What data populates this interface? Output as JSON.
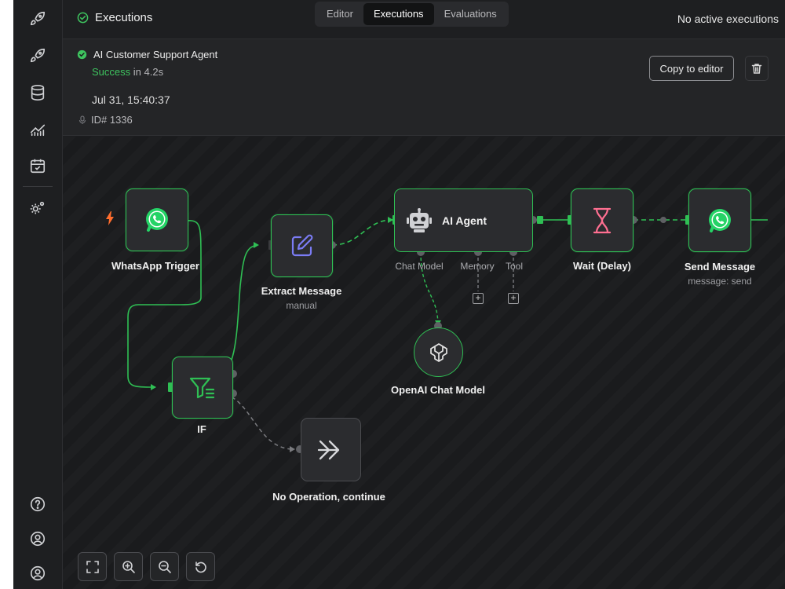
{
  "header": {
    "title": "Executions",
    "tabs": [
      {
        "label": "Editor"
      },
      {
        "label": "Executions"
      },
      {
        "label": "Evaluations"
      }
    ],
    "no_active": "No active executions"
  },
  "execution": {
    "workflow_name": "AI Customer Support Agent",
    "status": "Success",
    "duration": "in 4.2s",
    "date": "Jul 31, 15:40:37",
    "id": "ID# 1336",
    "copy_label": "Copy to editor"
  },
  "nodes": {
    "whatsapp_trigger": {
      "label": "WhatsApp Trigger"
    },
    "extract_message": {
      "label": "Extract Message",
      "sub": "manual"
    },
    "ai_agent": {
      "label": "AI Agent",
      "slots": [
        "Chat Model",
        "Memory",
        "Tool"
      ]
    },
    "wait": {
      "label": "Wait (Delay)"
    },
    "send_message": {
      "label": "Send Message",
      "sub": "message: send"
    },
    "if": {
      "label": "IF"
    },
    "no_op": {
      "label": "No Operation, continue"
    },
    "openai": {
      "label": "OpenAI Chat Model"
    }
  },
  "colors": {
    "success": "#3ec45f",
    "node_border": "#2fbf54",
    "whatsapp": "#25d366",
    "trigger_bolt": "#ff6d2d",
    "extract_icon": "#7b7cf5",
    "wait_icon": "#ff6f91"
  }
}
